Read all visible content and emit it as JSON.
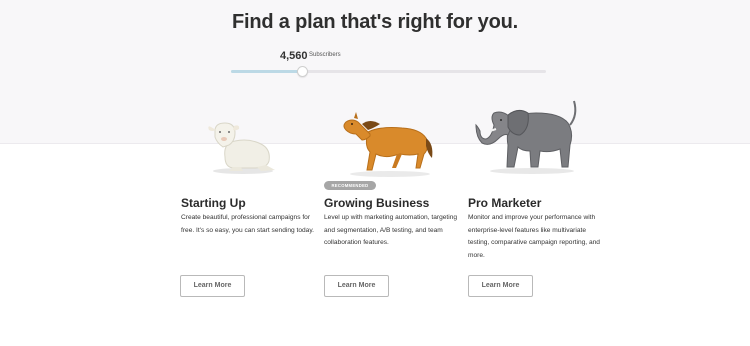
{
  "header": {
    "title": "Find a plan that's right for you."
  },
  "slider": {
    "value": "4,560",
    "unit": "Subscribers",
    "level_percent": 23
  },
  "plans": [
    {
      "name": "Starting Up",
      "description": "Create beautiful, professional campaigns for free. It's so easy, you can start sending today.",
      "cta": "Learn More",
      "illustration": "sheep-figurine"
    },
    {
      "name": "Growing Business",
      "badge": "RECOMMENDED",
      "description": "Level up with marketing automation, targeting and segmentation, A/B testing, and team collaboration features.",
      "cta": "Learn More",
      "illustration": "horse-figurine"
    },
    {
      "name": "Pro Marketer",
      "description": "Monitor and improve your performance with enterprise-level features like multivariate testing, comparative campaign reporting, and more.",
      "cta": "Learn More",
      "illustration": "elephant-figurine"
    }
  ],
  "colors": {
    "band": "#f8f7f9",
    "slider_fill": "#bcd9e6",
    "badge": "#a6a6a6",
    "button_border": "#b9b9b9"
  }
}
